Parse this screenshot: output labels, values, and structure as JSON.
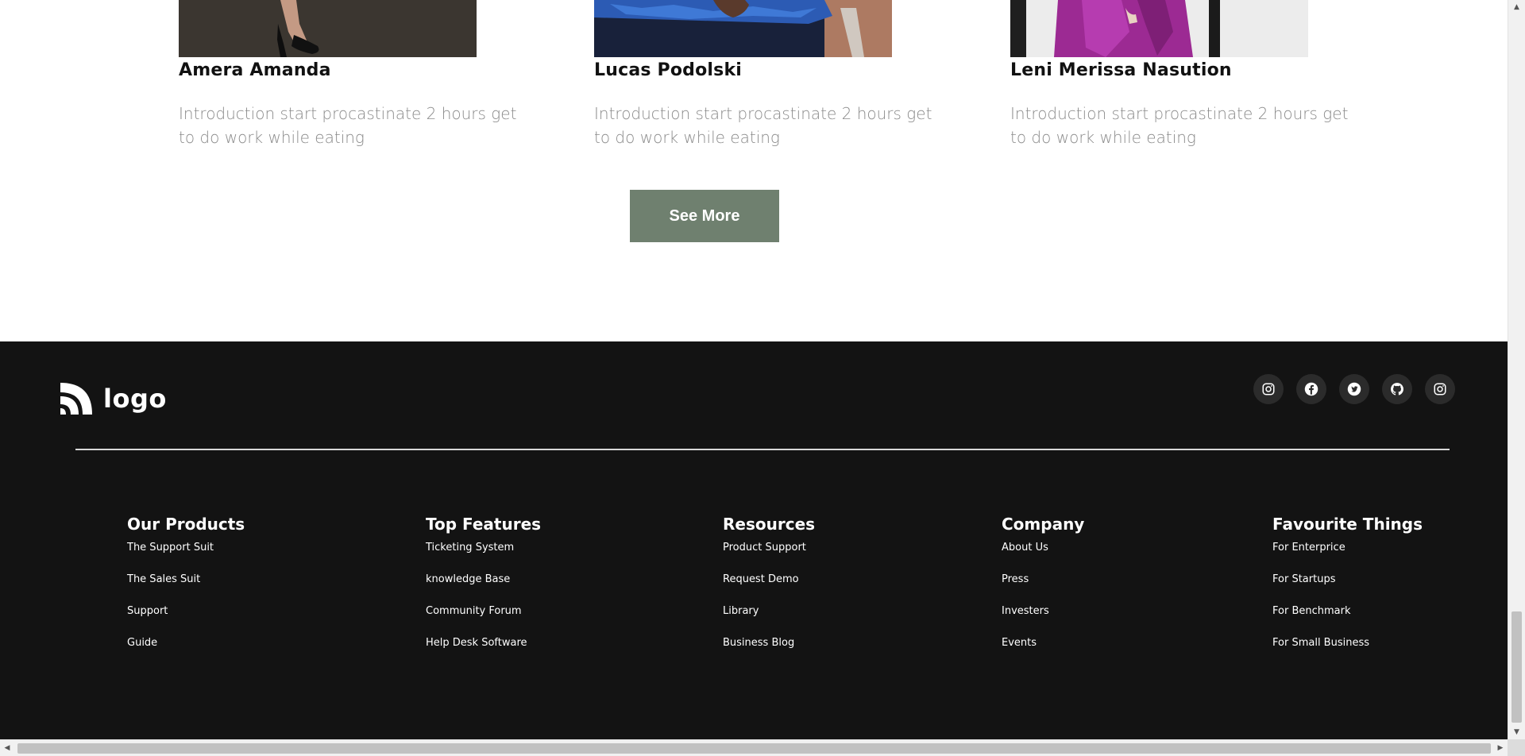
{
  "team": {
    "members": [
      {
        "name": "Amera Amanda",
        "desc": "Introduction start procastinate 2 hours get to do work while eating"
      },
      {
        "name": "Lucas Podolski",
        "desc": "Introduction start procastinate 2 hours get to do work while eating"
      },
      {
        "name": "Leni Merissa Nasution",
        "desc": "Introduction start procastinate 2 hours get to do work while eating"
      }
    ],
    "see_more_label": "See More"
  },
  "footer": {
    "logo_text": "logo",
    "socials": [
      "instagram-icon",
      "facebook-icon",
      "twitter-icon",
      "github-icon",
      "instagram-icon"
    ],
    "columns": [
      {
        "title": "Our Products",
        "links": [
          "The Support Suit",
          "The Sales Suit",
          "Support",
          "Guide"
        ]
      },
      {
        "title": "Top Features",
        "links": [
          "Ticketing System",
          "knowledge Base",
          "Community Forum",
          "Help Desk Software"
        ]
      },
      {
        "title": "Resources",
        "links": [
          "Product Support",
          "Request Demo",
          "Library",
          "Business Blog"
        ]
      },
      {
        "title": "Company",
        "links": [
          "About Us",
          "Press",
          "Investers",
          "Events"
        ]
      },
      {
        "title": "Favourite Things",
        "links": [
          "For Enterprice",
          "For Startups",
          "For Benchmark",
          "For Small Business"
        ]
      }
    ]
  },
  "colors": {
    "accent_button": "#6f806f",
    "footer_bg": "#131313"
  }
}
